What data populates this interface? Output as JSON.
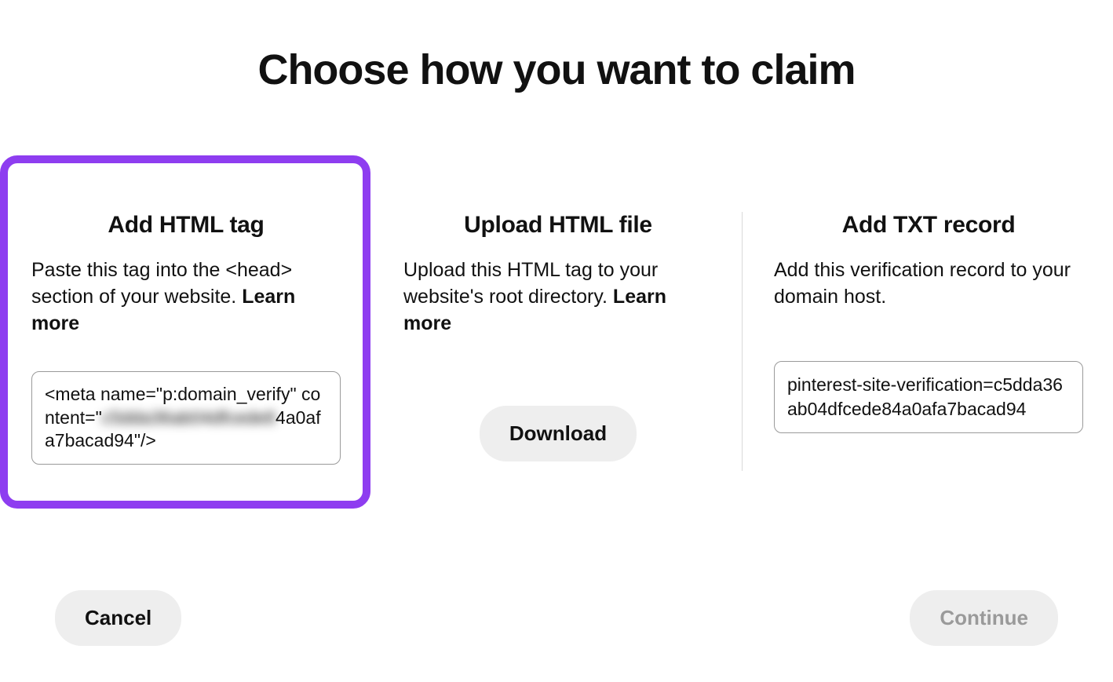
{
  "heading": "Choose how you want to claim",
  "options": {
    "html_tag": {
      "title": "Add HTML tag",
      "description": "Paste this tag into the <head> section of your website.",
      "learn_more": "Learn more",
      "code_pre": "<meta name=\"p:domain_verify\" content=\"",
      "code_masked": "c5dda36ab04dfcede8",
      "code_post": "4a0afa7bacad94\"/>"
    },
    "html_file": {
      "title": "Upload HTML file",
      "description": "Upload this HTML tag to your website's root directory.",
      "learn_more": "Learn more",
      "download_label": "Download"
    },
    "txt_record": {
      "title": "Add TXT record",
      "description": "Add this verification record to your domain host.",
      "txt_value": "pinterest-site-verification=c5dda36ab04dfcede84a0afa7bacad94"
    }
  },
  "footer": {
    "cancel": "Cancel",
    "continue": "Continue"
  }
}
